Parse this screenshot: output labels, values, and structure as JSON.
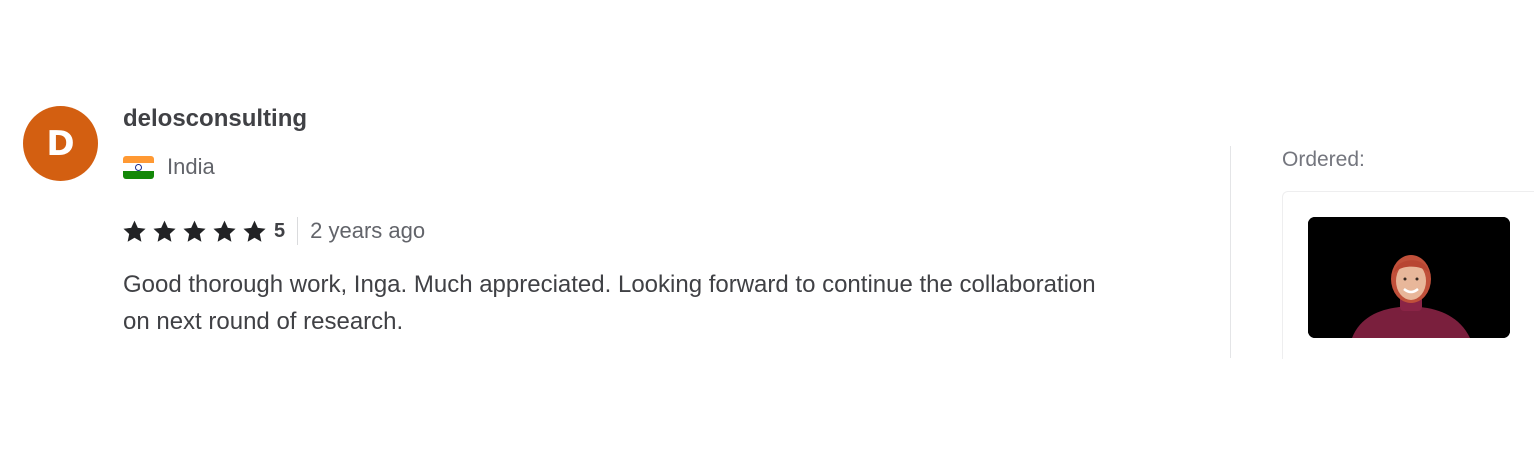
{
  "review": {
    "avatar_letter": "D",
    "avatar_color": "#d35f11",
    "username": "delosconsulting",
    "country": "India",
    "country_flag_icon": "india-flag-icon",
    "rating": "5",
    "star_count": 5,
    "time_ago": "2 years ago",
    "text": "Good thorough work, Inga. Much appreciated. Looking forward to continue the collaboration on next round of research."
  },
  "ordered": {
    "label": "Ordered:",
    "thumbnail_description": "gig-video-thumbnail"
  },
  "colors": {
    "text_primary": "#404145",
    "text_secondary": "#62646a",
    "star": "#222325"
  }
}
